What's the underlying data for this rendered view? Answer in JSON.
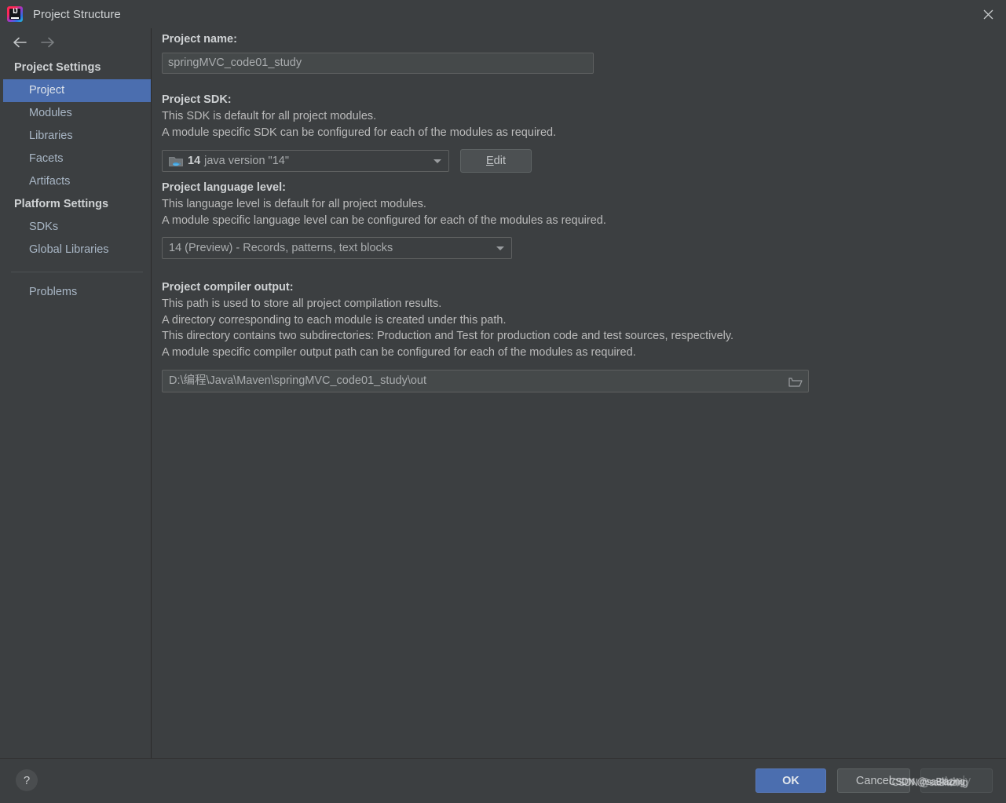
{
  "window": {
    "title": "Project Structure",
    "logo_icon": "intellij-idea-logo",
    "close_icon": "close-icon"
  },
  "sidebar": {
    "back_icon": "arrow-left-icon",
    "forward_icon": "arrow-right-icon",
    "groups": [
      {
        "header": "Project Settings",
        "items": [
          {
            "label": "Project",
            "selected": true
          },
          {
            "label": "Modules",
            "selected": false
          },
          {
            "label": "Libraries",
            "selected": false
          },
          {
            "label": "Facets",
            "selected": false
          },
          {
            "label": "Artifacts",
            "selected": false
          }
        ]
      },
      {
        "header": "Platform Settings",
        "items": [
          {
            "label": "SDKs",
            "selected": false
          },
          {
            "label": "Global Libraries",
            "selected": false
          }
        ]
      }
    ],
    "problems_label": "Problems"
  },
  "main": {
    "project_name": {
      "label": "Project name:",
      "value": "springMVC_code01_study"
    },
    "project_sdk": {
      "label": "Project SDK:",
      "desc_line1": "This SDK is default for all project modules.",
      "desc_line2": "A module specific SDK can be configured for each of the modules as required.",
      "sdk_icon": "java-sdk-folder-icon",
      "sdk_version": "14",
      "sdk_name": "java version \"14\"",
      "edit_button_mnemonic": "E",
      "edit_button_rest": "dit",
      "dropdown_icon": "chevron-down-icon"
    },
    "language_level": {
      "label": "Project language level:",
      "desc_line1": "This language level is default for all project modules.",
      "desc_line2": "A module specific language level can be configured for each of the modules as required.",
      "value": "14 (Preview) - Records, patterns, text blocks",
      "dropdown_icon": "chevron-down-icon"
    },
    "compiler_output": {
      "label": "Project compiler output:",
      "desc_line1": "This path is used to store all project compilation results.",
      "desc_line2": "A directory corresponding to each module is created under this path.",
      "desc_line3": "This directory contains two subdirectories: Production and Test for production code and test sources, respectively.",
      "desc_line4": "A module specific compiler output path can be configured for each of the modules as required.",
      "value": "D:\\编程\\Java\\Maven\\springMVC_code01_study\\out",
      "browse_icon": "folder-browse-icon"
    }
  },
  "footer": {
    "help_icon": "?",
    "ok_label": "OK",
    "cancel_label": "Cancel",
    "apply_label": "Apply"
  },
  "watermark": {
    "text_a": "CSDN @saBlazing",
    "text_b": "CSDN @saBlazing"
  },
  "colors": {
    "background": "#3C3F41",
    "selection_blue": "#4B6EAF",
    "text": "#BBBBBB",
    "text_bright": "#CFD2D4",
    "field_background": "#45494A",
    "border": "#5E6060"
  }
}
